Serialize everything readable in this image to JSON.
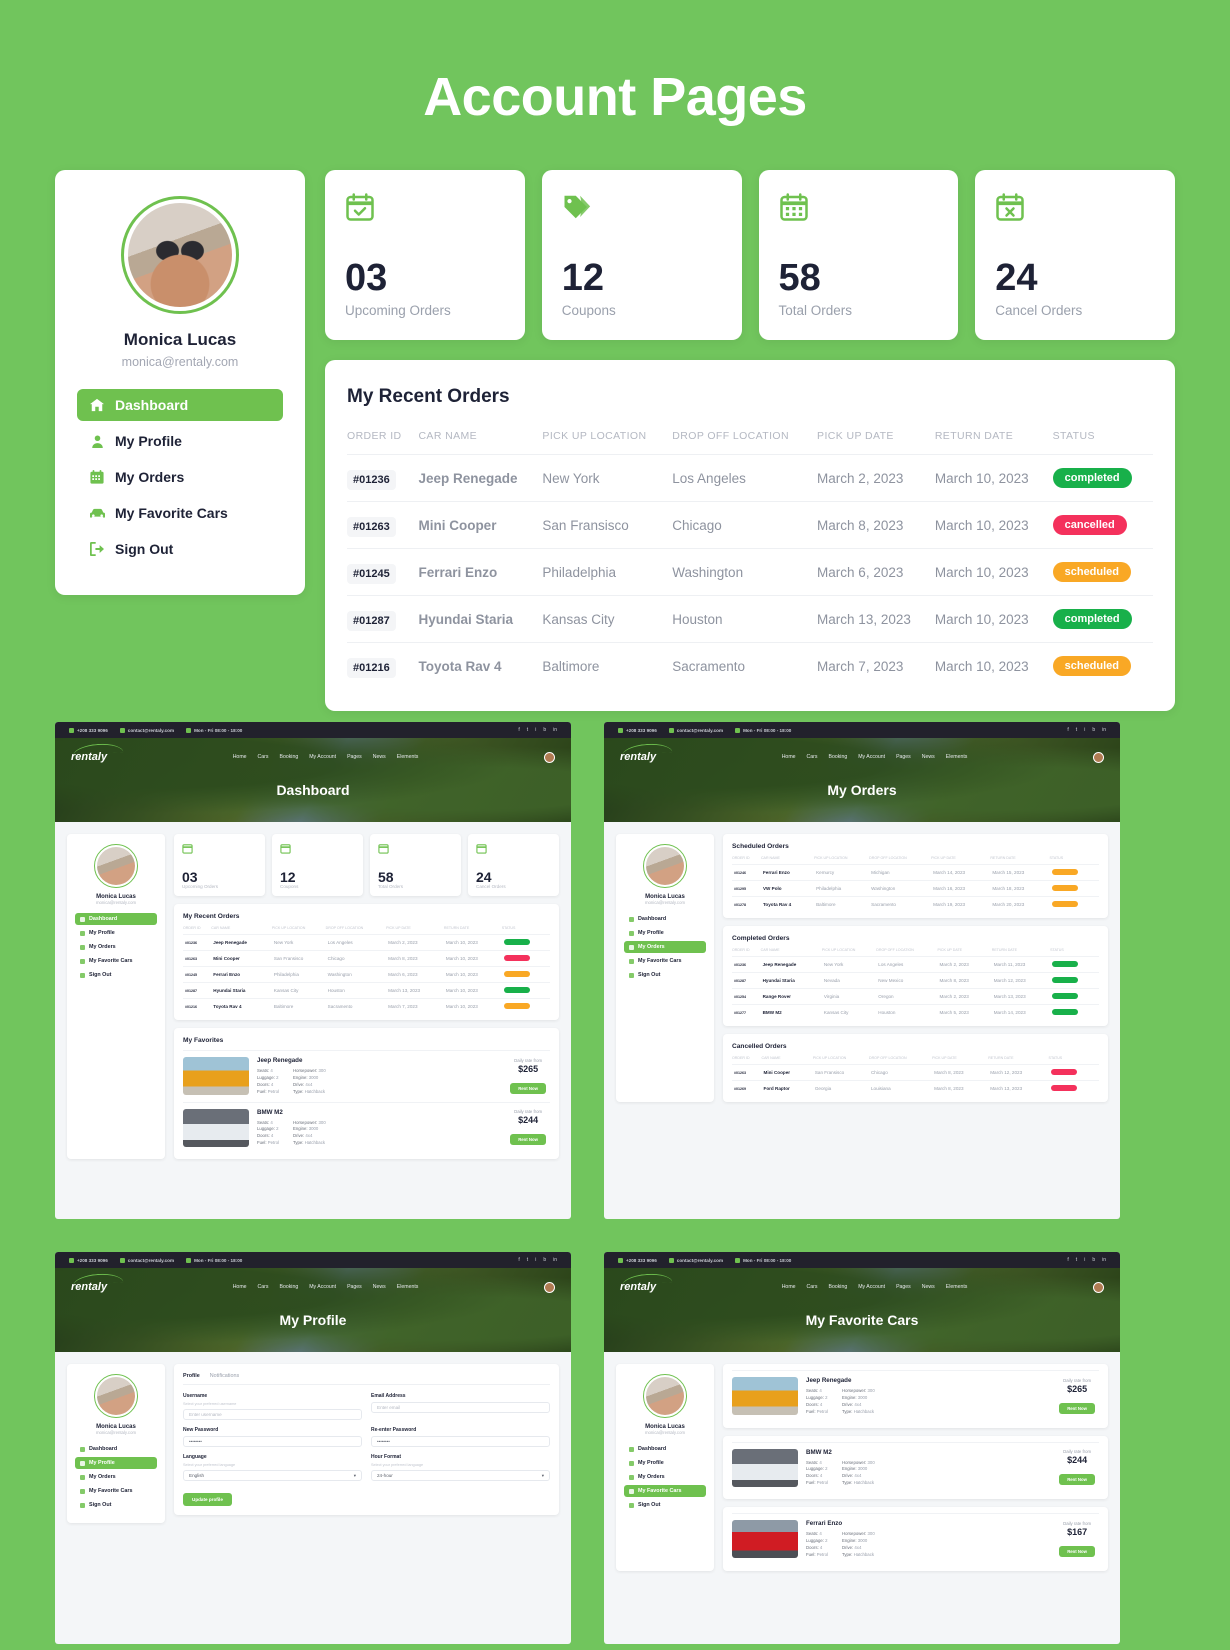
{
  "page": {
    "title": "Account Pages"
  },
  "colors": {
    "brand": "#71c55d",
    "accent": "#6fc14f",
    "completed": "#18b04a",
    "cancelled": "#f4315c",
    "scheduled": "#f9a825",
    "dark": "#1e2236"
  },
  "profile": {
    "name": "Monica Lucas",
    "email": "monica@rentaly.com",
    "nav": [
      {
        "label": "Dashboard",
        "icon": "home-icon",
        "active": true
      },
      {
        "label": "My Profile",
        "icon": "user-icon",
        "active": false
      },
      {
        "label": "My Orders",
        "icon": "calendar-icon",
        "active": false
      },
      {
        "label": "My Favorite Cars",
        "icon": "car-icon",
        "active": false
      },
      {
        "label": "Sign Out",
        "icon": "signout-icon",
        "active": false
      }
    ]
  },
  "stats": [
    {
      "value": "03",
      "label": "Upcoming Orders",
      "icon": "calendar-check-icon"
    },
    {
      "value": "12",
      "label": "Coupons",
      "icon": "tag-icon"
    },
    {
      "value": "58",
      "label": "Total Orders",
      "icon": "calendar-grid-icon"
    },
    {
      "value": "24",
      "label": "Cancel Orders",
      "icon": "calendar-x-icon"
    }
  ],
  "orders": {
    "title": "My Recent Orders",
    "columns": [
      "ORDER ID",
      "CAR NAME",
      "PICK UP LOCATION",
      "DROP OFF LOCATION",
      "PICK UP DATE",
      "RETURN DATE",
      "STATUS"
    ],
    "rows": [
      {
        "id": "#01236",
        "car": "Jeep Renegade",
        "pickup": "New York",
        "dropoff": "Los Angeles",
        "pickup_date": "March 2, 2023",
        "return_date": "March 10, 2023",
        "status": "completed"
      },
      {
        "id": "#01263",
        "car": "Mini Cooper",
        "pickup": "San Fransisco",
        "dropoff": "Chicago",
        "pickup_date": "March 8, 2023",
        "return_date": "March 10, 2023",
        "status": "cancelled"
      },
      {
        "id": "#01245",
        "car": "Ferrari Enzo",
        "pickup": "Philadelphia",
        "dropoff": "Washington",
        "pickup_date": "March 6, 2023",
        "return_date": "March 10, 2023",
        "status": "scheduled"
      },
      {
        "id": "#01287",
        "car": "Hyundai Staria",
        "pickup": "Kansas City",
        "dropoff": "Houston",
        "pickup_date": "March 13, 2023",
        "return_date": "March 10, 2023",
        "status": "completed"
      },
      {
        "id": "#01216",
        "car": "Toyota Rav 4",
        "pickup": "Baltimore",
        "dropoff": "Sacramento",
        "pickup_date": "March 7, 2023",
        "return_date": "March 10, 2023",
        "status": "scheduled"
      }
    ]
  },
  "site": {
    "topbar": {
      "phone": "+208 333 9096",
      "email": "contact@rentaly.com",
      "hours": "Mon - Fri 08:00 - 18:00"
    },
    "logo": "rentaly",
    "menu": [
      "Home",
      "Cars",
      "Booking",
      "My Account",
      "Pages",
      "News",
      "Elements"
    ],
    "social": [
      "f",
      "t",
      "i",
      "b",
      "in"
    ]
  },
  "thumbs": [
    {
      "hero_title": "Dashboard"
    },
    {
      "hero_title": "My Orders"
    },
    {
      "hero_title": "My Profile"
    },
    {
      "hero_title": "My Favorite Cars"
    }
  ],
  "favorites": {
    "title": "My Favorites",
    "rate_label": "Daily rate from",
    "rent_label": "Rent Now",
    "cars": [
      {
        "name": "Jeep Renegade",
        "price": "$265",
        "img": "jeep",
        "specs_left": [
          [
            "Seats:",
            "4"
          ],
          [
            "Luggage:",
            "2"
          ],
          [
            "Doors:",
            "4"
          ],
          [
            "Fuel:",
            "Petrol"
          ]
        ],
        "specs_right": [
          [
            "Horsepower:",
            "300"
          ],
          [
            "Engine:",
            "3000"
          ],
          [
            "Drive:",
            "4x4"
          ],
          [
            "Type:",
            "Hatchback"
          ]
        ]
      },
      {
        "name": "BMW M2",
        "price": "$244",
        "img": "bmw",
        "specs_left": [
          [
            "Seats:",
            "4"
          ],
          [
            "Luggage:",
            "2"
          ],
          [
            "Doors:",
            "4"
          ],
          [
            "Fuel:",
            "Petrol"
          ]
        ],
        "specs_right": [
          [
            "Horsepower:",
            "300"
          ],
          [
            "Engine:",
            "3000"
          ],
          [
            "Drive:",
            "4x4"
          ],
          [
            "Type:",
            "Hatchback"
          ]
        ]
      },
      {
        "name": "Ferrari Enzo",
        "price": "$167",
        "img": "ferrari",
        "specs_left": [
          [
            "Seats:",
            "4"
          ],
          [
            "Luggage:",
            "2"
          ],
          [
            "Doors:",
            "4"
          ],
          [
            "Fuel:",
            "Petrol"
          ]
        ],
        "specs_right": [
          [
            "Horsepower:",
            "300"
          ],
          [
            "Engine:",
            "3000"
          ],
          [
            "Drive:",
            "4x4"
          ],
          [
            "Type:",
            "Hatchback"
          ]
        ]
      }
    ]
  },
  "my_orders": {
    "columns": [
      "ORDER ID",
      "CAR NAME",
      "PICK UP LOCATION",
      "DROP OFF LOCATION",
      "PICK UP DATE",
      "RETURN DATE",
      "STATUS"
    ],
    "sections": [
      {
        "title": "Scheduled Orders",
        "status": "scheduled",
        "rows": [
          {
            "id": "#01246",
            "car": "Ferrari Enzo",
            "pickup": "Kemurcy",
            "dropoff": "Michigan",
            "pickup_date": "March 14, 2023",
            "return_date": "March 15, 2023"
          },
          {
            "id": "#01295",
            "car": "VW Polo",
            "pickup": "Philadelphia",
            "dropoff": "Washington",
            "pickup_date": "March 16, 2023",
            "return_date": "March 18, 2023"
          },
          {
            "id": "#01278",
            "car": "Toyota Rav 4",
            "pickup": "Baltimore",
            "dropoff": "Sacramento",
            "pickup_date": "March 19, 2023",
            "return_date": "March 20, 2023"
          }
        ]
      },
      {
        "title": "Completed Orders",
        "status": "completed",
        "rows": [
          {
            "id": "#01236",
            "car": "Jeep Renegade",
            "pickup": "New York",
            "dropoff": "Los Angeles",
            "pickup_date": "March 2, 2023",
            "return_date": "March 11, 2023"
          },
          {
            "id": "#01287",
            "car": "Hyundai Staria",
            "pickup": "Nevada",
            "dropoff": "New Mexico",
            "pickup_date": "March 8, 2023",
            "return_date": "March 12, 2023"
          },
          {
            "id": "#01254",
            "car": "Range Rover",
            "pickup": "Virginia",
            "dropoff": "Oregon",
            "pickup_date": "March 2, 2023",
            "return_date": "March 13, 2023"
          },
          {
            "id": "#01277",
            "car": "BMW M2",
            "pickup": "Kansas City",
            "dropoff": "Houston",
            "pickup_date": "March 5, 2023",
            "return_date": "March 14, 2023"
          }
        ]
      },
      {
        "title": "Cancelled Orders",
        "status": "cancelled",
        "rows": [
          {
            "id": "#01263",
            "car": "Mini Cooper",
            "pickup": "San Fransisco",
            "dropoff": "Chicago",
            "pickup_date": "March 8, 2023",
            "return_date": "March 12, 2023"
          },
          {
            "id": "#01269",
            "car": "Ford Raptor",
            "pickup": "Georgia",
            "dropoff": "Louisiana",
            "pickup_date": "March 8, 2023",
            "return_date": "March 13, 2023"
          }
        ]
      }
    ]
  },
  "profile_form": {
    "tabs": [
      "Profile",
      "Notifications"
    ],
    "fields": [
      {
        "label": "Username",
        "hint": "Select your preferred username",
        "placeholder": "Enter username",
        "value": ""
      },
      {
        "label": "Email Address",
        "hint": "",
        "placeholder": "Enter email",
        "value": ""
      },
      {
        "label": "New Password",
        "hint": "",
        "placeholder": "",
        "value": "••••••••"
      },
      {
        "label": "Re-enter Password",
        "hint": "",
        "placeholder": "",
        "value": "••••••••"
      }
    ],
    "selects": [
      {
        "label": "Language",
        "hint": "Select your preferred language",
        "value": "English"
      },
      {
        "label": "Hour Format",
        "hint": "Select your preferred language",
        "value": "24-hour"
      }
    ],
    "submit": "Update profile"
  }
}
